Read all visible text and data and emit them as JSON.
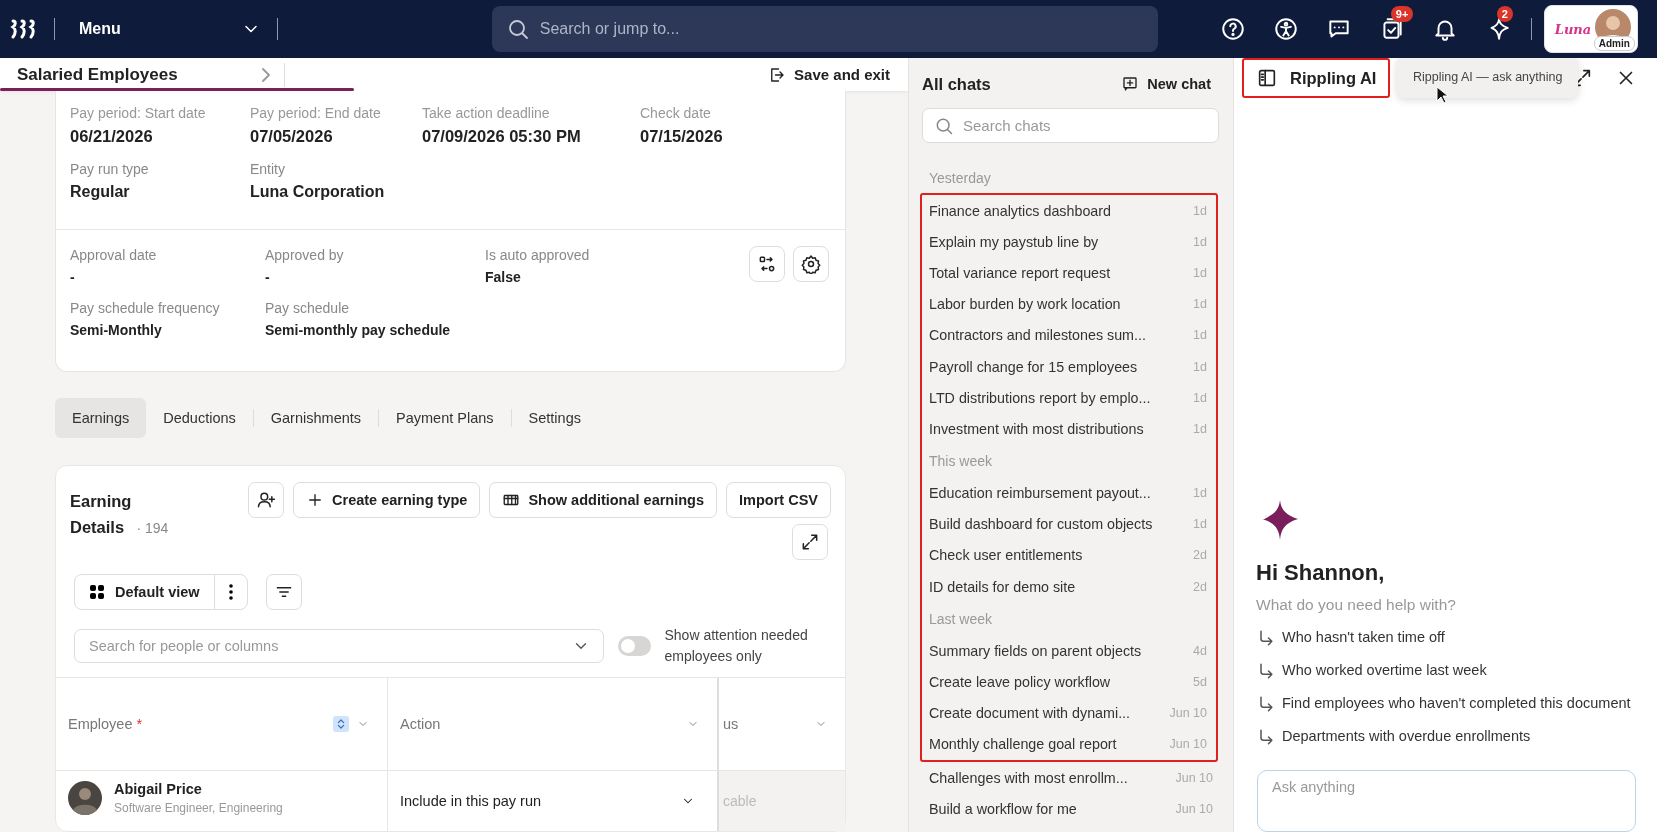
{
  "top_bar": {
    "menu_label": "Menu",
    "search": {
      "placeholder": "Search or jump to..."
    },
    "tasks_badge": "9+",
    "ai_badge": "2",
    "account": {
      "logo_text": "Luna",
      "role": "Admin"
    }
  },
  "page_header": {
    "title": "Salaried Employees",
    "save_button": "Save and exit",
    "progress": {
      "level": 0.39
    }
  },
  "summary": {
    "sections": [
      {
        "rows": [
          [
            {
              "label": "Pay period: Start date",
              "value": "06/21/2026"
            },
            {
              "label": "Pay period: End date",
              "value": "07/05/2026"
            },
            {
              "label": "Take action deadline",
              "value": "07/09/2026 05:30 PM"
            },
            {
              "label": "Check date",
              "value": "07/15/2026"
            }
          ],
          [
            {
              "label": "Pay run type",
              "value": "Regular"
            },
            {
              "label": "Entity",
              "value": "Luna Corporation"
            }
          ]
        ]
      },
      {
        "rows": [
          [
            {
              "label": "Approval date",
              "value": "-"
            },
            {
              "label": "Approved by",
              "value": "-"
            },
            {
              "label": "Is auto approved",
              "value": "False"
            }
          ],
          [
            {
              "label": "Pay schedule frequency",
              "value": "Semi-Monthly"
            },
            {
              "label": "Pay schedule",
              "value": "Semi-monthly pay schedule"
            }
          ]
        ]
      }
    ]
  },
  "tabs": [
    {
      "label": "Earnings",
      "selected": true
    },
    {
      "label": "Deductions",
      "selected": false
    },
    {
      "label": "Garnishments",
      "selected": false
    },
    {
      "label": "Payment Plans",
      "selected": false
    },
    {
      "label": "Settings",
      "selected": false
    }
  ],
  "earnings": {
    "title": "Earning Details",
    "count": "· 194",
    "buttons": [
      "Create earning type",
      "Show additional earnings",
      "Import CSV"
    ],
    "view": "Default view",
    "search": {
      "placeholder": "Search for people or columns"
    },
    "toggle": {
      "label": "Show attention needed employees only",
      "on": false
    },
    "table": {
      "columns": [
        {
          "label": "Employee",
          "required_mark": "*"
        },
        {
          "label": "Action"
        },
        {
          "label": "us"
        }
      ],
      "rows": [
        {
          "name": "Abigail Price",
          "subtitle": "Software Engineer, Engineering",
          "action": "Include in this pay run",
          "column_3": "cable"
        }
      ]
    }
  },
  "chats": {
    "title": "All chats",
    "new_chat": "New chat",
    "search": {
      "placeholder": "Search chats"
    },
    "groups": [
      {
        "highlighted": false,
        "entries": [
          {
            "kind": "section",
            "label": "Yesterday"
          }
        ]
      },
      {
        "highlighted": true,
        "entries": [
          {
            "kind": "chat",
            "title": "Finance analytics dashboard",
            "age": "1d"
          },
          {
            "kind": "chat",
            "title": "Explain my paystub line by",
            "age": "1d"
          },
          {
            "kind": "chat",
            "title": "Total variance report request",
            "age": "1d"
          },
          {
            "kind": "chat",
            "title": "Labor burden by work location",
            "age": "1d"
          },
          {
            "kind": "chat",
            "title": "Contractors and milestones sum...",
            "age": "1d"
          },
          {
            "kind": "chat",
            "title": "Payroll change for 15 employees",
            "age": "1d"
          },
          {
            "kind": "chat",
            "title": "LTD distributions report by emplo...",
            "age": "1d"
          },
          {
            "kind": "chat",
            "title": "Investment with most distributions",
            "age": "1d"
          },
          {
            "kind": "section",
            "label": "This week"
          },
          {
            "kind": "chat",
            "title": "Education reimbursement payout...",
            "age": "1d"
          },
          {
            "kind": "chat",
            "title": "Build dashboard for custom objects",
            "age": "1d"
          },
          {
            "kind": "chat",
            "title": "Check user entitlements",
            "age": "2d"
          },
          {
            "kind": "chat",
            "title": "ID details for demo site",
            "age": "2d"
          },
          {
            "kind": "section",
            "label": "Last week"
          },
          {
            "kind": "chat",
            "title": "Summary fields on parent objects",
            "age": "4d"
          },
          {
            "kind": "chat",
            "title": "Create leave policy workflow",
            "age": "5d"
          },
          {
            "kind": "chat",
            "title": "Create document with dynami...",
            "age": "Jun 10"
          },
          {
            "kind": "chat",
            "title": "Monthly challenge goal report",
            "age": "Jun 10"
          }
        ]
      },
      {
        "highlighted": false,
        "entries": [
          {
            "kind": "chat",
            "title": "Challenges with most enrollm...",
            "age": "Jun 10"
          },
          {
            "kind": "chat",
            "title": "Build a workflow for me",
            "age": "Jun 10"
          }
        ]
      }
    ]
  },
  "ai_panel": {
    "title": "Rippling AI",
    "highlighted": true,
    "tooltip": "Rippling AI — ask anything",
    "greeting": "Hi Shannon,",
    "prompt": "What do you need help with?",
    "suggestions": [
      "Who hasn't taken time off",
      "Who worked overtime last week",
      "Find employees who haven't completed this document",
      "Departments with overdue enrollments"
    ],
    "input": {
      "placeholder": "Ask anything"
    }
  }
}
